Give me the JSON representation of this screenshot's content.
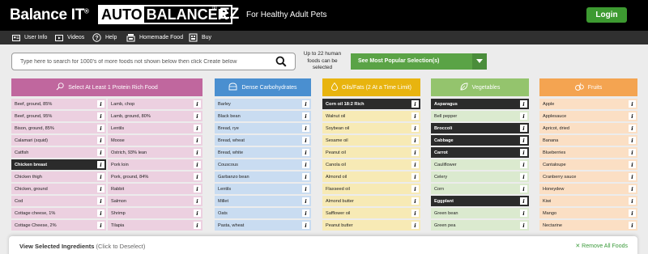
{
  "header": {
    "brand": "Balance IT",
    "brand_mark": "®",
    "product_part1": "AUTO",
    "product_part2": "BALANCER",
    "product_mark": "®",
    "product_suffix": "EZ",
    "tagline": "For Healthy Adult Pets",
    "login_label": "Login"
  },
  "nav": [
    {
      "label": "User Info",
      "icon": "user-info-icon"
    },
    {
      "label": "Videos",
      "icon": "video-icon"
    },
    {
      "label": "Help",
      "icon": "help-icon"
    },
    {
      "label": "Homemade Food",
      "icon": "homemade-food-icon"
    },
    {
      "label": "Buy",
      "icon": "cart-icon"
    }
  ],
  "search": {
    "placeholder": "Type here to search for 1000's of more foods not shown below then click Create below",
    "limit_text": "Up to 22 human foods can be selected",
    "popular_label": "See Most Popular Selection(s)"
  },
  "colors": {
    "protein_head": "#c0679e",
    "protein_cell": "#ecd0e0",
    "carb_head": "#4a8fd0",
    "carb_cell": "#c9dcf1",
    "fat_head": "#e8b40f",
    "fat_cell": "#f7eab5",
    "veg_head": "#94c46d",
    "veg_cell": "#dbeacf",
    "fruit_head": "#f4a451",
    "fruit_cell": "#fbdfc4",
    "selected": "#2b2b2b"
  },
  "columns": {
    "protein": {
      "title": "Select At Least 1 Protein Rich Food",
      "icon": "meat-icon",
      "left": [
        {
          "name": "Beef, ground, 85%",
          "selected": false
        },
        {
          "name": "Beef, ground, 95%",
          "selected": false
        },
        {
          "name": "Bison, ground, 85%",
          "selected": false
        },
        {
          "name": "Calamari (squid)",
          "selected": false
        },
        {
          "name": "Catfish",
          "selected": false
        },
        {
          "name": "Chicken breast",
          "selected": true
        },
        {
          "name": "Chicken thigh",
          "selected": false
        },
        {
          "name": "Chicken, ground",
          "selected": false
        },
        {
          "name": "Cod",
          "selected": false
        },
        {
          "name": "Cottage cheese, 1%",
          "selected": false
        },
        {
          "name": "Cottage Cheese, 2%",
          "selected": false
        }
      ],
      "right": [
        {
          "name": "Lamb, chop",
          "selected": false
        },
        {
          "name": "Lamb, ground, 80%",
          "selected": false
        },
        {
          "name": "Lentils",
          "selected": false
        },
        {
          "name": "Moose",
          "selected": false
        },
        {
          "name": "Ostrich, 93% lean",
          "selected": false
        },
        {
          "name": "Pork loin",
          "selected": false
        },
        {
          "name": "Pork, ground, 84%",
          "selected": false
        },
        {
          "name": "Rabbit",
          "selected": false
        },
        {
          "name": "Salmon",
          "selected": false
        },
        {
          "name": "Shrimp",
          "selected": false
        },
        {
          "name": "Tilapia",
          "selected": false
        }
      ]
    },
    "carbs": {
      "title": "Dense Carbohydrates",
      "icon": "bread-icon",
      "items": [
        {
          "name": "Barley",
          "selected": false
        },
        {
          "name": "Black bean",
          "selected": false
        },
        {
          "name": "Bread, rye",
          "selected": false
        },
        {
          "name": "Bread, wheat",
          "selected": false
        },
        {
          "name": "Bread, white",
          "selected": false
        },
        {
          "name": "Couscous",
          "selected": false
        },
        {
          "name": "Garbanzo bean",
          "selected": false
        },
        {
          "name": "Lentils",
          "selected": false
        },
        {
          "name": "Millet",
          "selected": false
        },
        {
          "name": "Oats",
          "selected": false
        },
        {
          "name": "Pasta, wheat",
          "selected": false
        }
      ]
    },
    "fats": {
      "title": "Oils/Fats (2 At a Time Limit)",
      "icon": "oil-drop-icon",
      "items": [
        {
          "name": "Corn oil 18:2 Rich",
          "selected": true
        },
        {
          "name": "Walnut oil",
          "selected": false
        },
        {
          "name": "Soybean oil",
          "selected": false
        },
        {
          "name": "Sesame oil",
          "selected": false
        },
        {
          "name": "Peanut oil",
          "selected": false
        },
        {
          "name": "Canola oil",
          "selected": false
        },
        {
          "name": "Almond oil",
          "selected": false
        },
        {
          "name": "Flaxseed oil",
          "selected": false
        },
        {
          "name": "Almond butter",
          "selected": false
        },
        {
          "name": "Safflower oil",
          "selected": false
        },
        {
          "name": "Peanut butter",
          "selected": false
        }
      ]
    },
    "veg": {
      "title": "Vegetables",
      "icon": "leaf-icon",
      "items": [
        {
          "name": "Asparagus",
          "selected": true
        },
        {
          "name": "Bell pepper",
          "selected": false
        },
        {
          "name": "Broccoli",
          "selected": true
        },
        {
          "name": "Cabbage",
          "selected": true
        },
        {
          "name": "Carrot",
          "selected": true
        },
        {
          "name": "Cauliflower",
          "selected": false
        },
        {
          "name": "Celery",
          "selected": false
        },
        {
          "name": "Corn",
          "selected": false
        },
        {
          "name": "Eggplant",
          "selected": true
        },
        {
          "name": "Green bean",
          "selected": false
        },
        {
          "name": "Green pea",
          "selected": false
        }
      ]
    },
    "fruits": {
      "title": "Fruits",
      "icon": "fruit-icon",
      "items": [
        {
          "name": "Apple",
          "selected": false
        },
        {
          "name": "Applesauce",
          "selected": false
        },
        {
          "name": "Apricot, dried",
          "selected": false
        },
        {
          "name": "Banana",
          "selected": false
        },
        {
          "name": "Blueberries",
          "selected": false
        },
        {
          "name": "Cantaloupe",
          "selected": false
        },
        {
          "name": "Cranberry sauce",
          "selected": false
        },
        {
          "name": "Honeydew",
          "selected": false
        },
        {
          "name": "Kiwi",
          "selected": false
        },
        {
          "name": "Mango",
          "selected": false
        },
        {
          "name": "Nectarine",
          "selected": false
        }
      ]
    }
  },
  "info_label": "i",
  "bottom": {
    "title": "View Selected Ingredients",
    "hint": "(Click to Deselect)",
    "remove_all": "✕ Remove All Foods"
  }
}
